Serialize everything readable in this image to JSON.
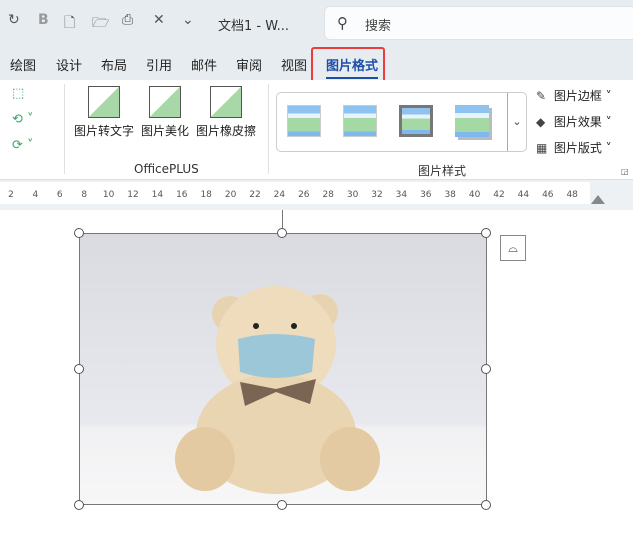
{
  "title_bar": {
    "doc_title": "文档1 - W...",
    "search_placeholder": "搜索",
    "quick_access": [
      "↻",
      "B",
      "🗋",
      "🗁",
      "⎙",
      "✕",
      "⌄"
    ]
  },
  "tabs": [
    {
      "label": "绘图"
    },
    {
      "label": "设计"
    },
    {
      "label": "布局"
    },
    {
      "label": "引用"
    },
    {
      "label": "邮件"
    },
    {
      "label": "审阅"
    },
    {
      "label": "视图"
    },
    {
      "label": "图片格式",
      "active": true
    }
  ],
  "ribbon": {
    "officeplus": {
      "label": "OfficePLUS",
      "buttons": [
        "图片转文字",
        "图片美化",
        "图片橡皮擦"
      ]
    },
    "picture_styles": {
      "label": "图片样式"
    },
    "right_buttons": [
      "图片边框",
      "图片效果",
      "图片版式"
    ]
  },
  "ruler": {
    "ticks": [
      "2",
      "4",
      "6",
      "8",
      "10",
      "12",
      "14",
      "16",
      "18",
      "20",
      "22",
      "24",
      "26",
      "28",
      "30",
      "32",
      "34",
      "36",
      "38",
      "40",
      "42",
      "44",
      "46",
      "48"
    ]
  },
  "colors": {
    "accent": "#1d4fa8",
    "highlight": "#ee3b3b"
  }
}
